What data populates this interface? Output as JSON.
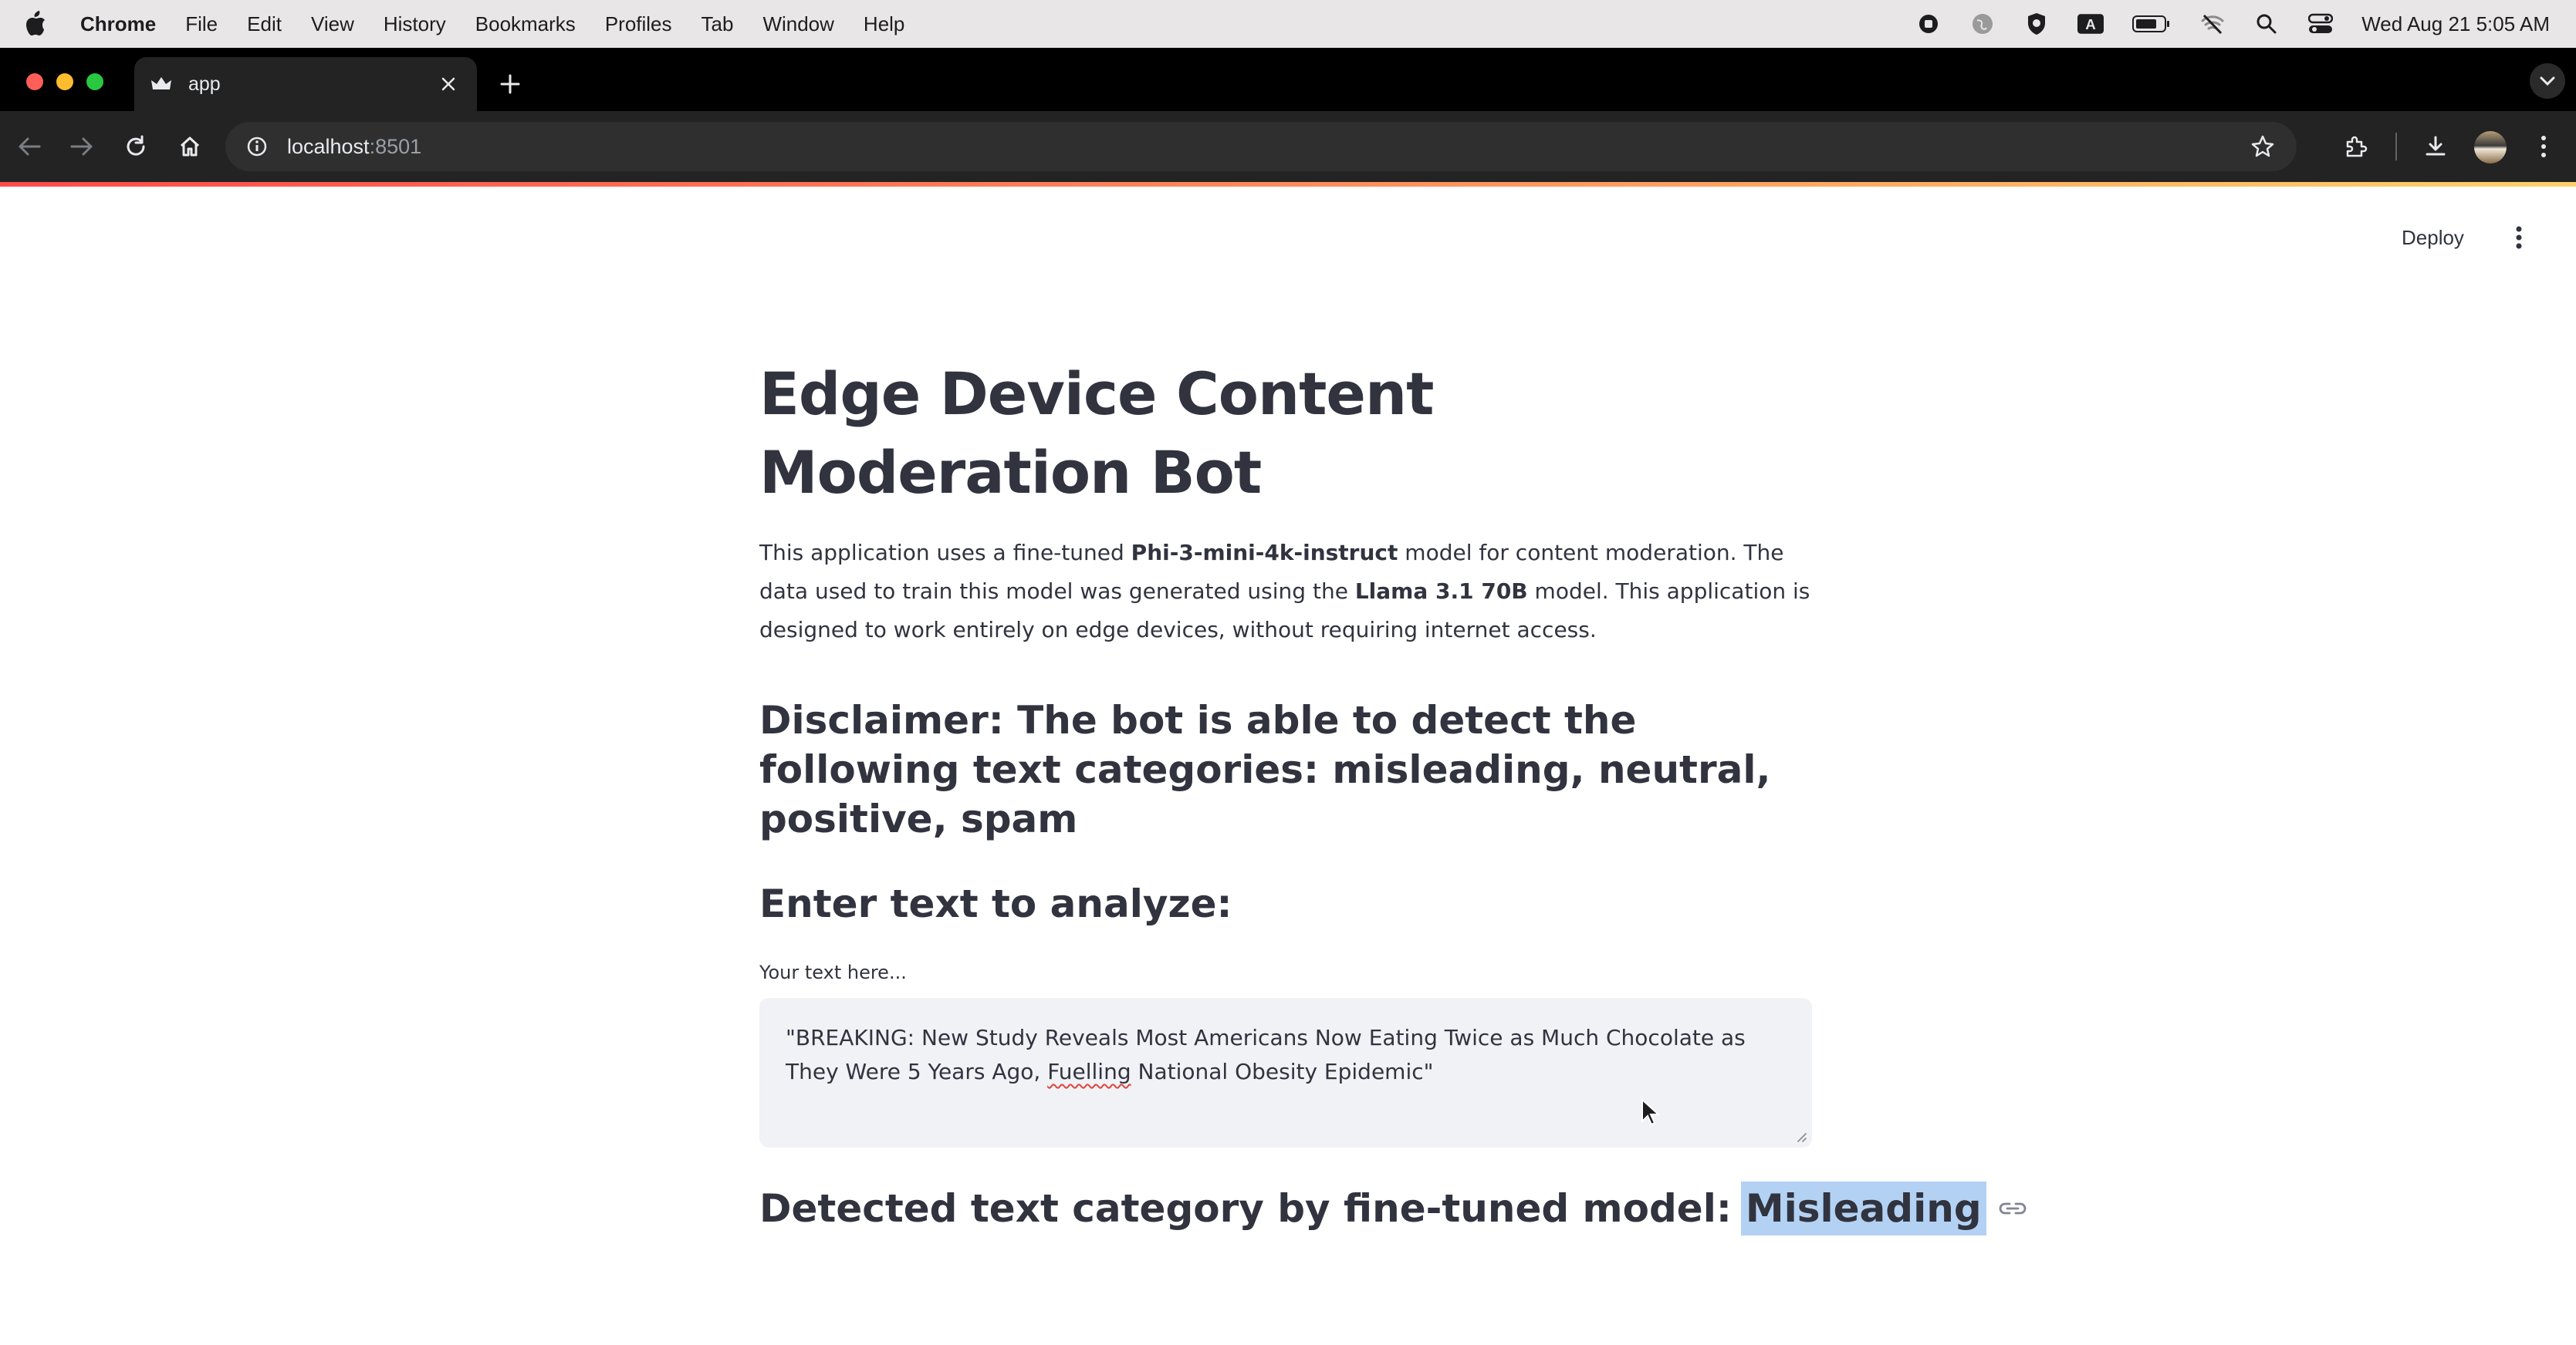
{
  "menubar": {
    "app_name": "Chrome",
    "items": [
      "File",
      "Edit",
      "View",
      "History",
      "Bookmarks",
      "Profiles",
      "Tab",
      "Window",
      "Help"
    ],
    "clock": "Wed Aug 21  5:05 AM",
    "status_icons": [
      "record-icon",
      "globe-icon",
      "shield-icon",
      "keyboard-input-icon",
      "battery-icon",
      "wifi-off-icon",
      "spotlight-search-icon",
      "control-center-icon"
    ]
  },
  "browser": {
    "tab_title": "app",
    "url_host": "localhost",
    "url_port": ":8501"
  },
  "streamlit_header": {
    "deploy_label": "Deploy"
  },
  "page": {
    "title": "Edge Device Content Moderation Bot",
    "intro": {
      "part1": "This application uses a fine-tuned ",
      "model_name": "Phi-3-mini-4k-instruct",
      "part2": " model for content moderation. The data used to train this model was generated using the ",
      "data_model": "Llama 3.1 70B",
      "part3": " model. This application is designed to work entirely on edge devices, without requiring internet access."
    },
    "disclaimer": "Disclaimer: The bot is able to detect the following text categories: misleading, neutral, positive, spam",
    "enter_heading": "Enter text to analyze:",
    "input": {
      "label": "Your text here...",
      "value_part1": "\"BREAKING: New Study Reveals Most Americans Now Eating Twice as Much Chocolate as They Were 5 Years Ago, ",
      "value_misspelled": "Fuelling",
      "value_part2": " National Obesity Epidemic\""
    },
    "result": {
      "label": "Detected text category by fine-tuned model: ",
      "category": "Misleading"
    }
  },
  "colors": {
    "text": "#31333f",
    "textarea_bg": "#f0f2f6",
    "selection_highlight": "#b3d2f3",
    "accent_red": "#ff4b4b"
  }
}
